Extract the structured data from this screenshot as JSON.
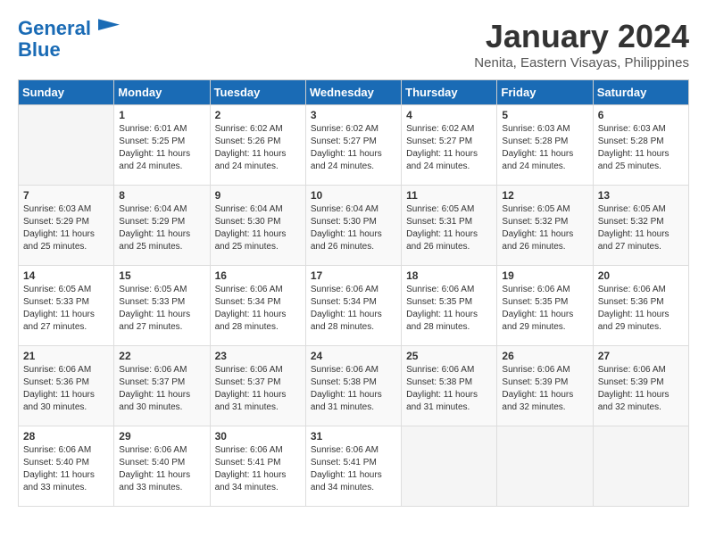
{
  "header": {
    "logo_line1": "General",
    "logo_line2": "Blue",
    "month": "January 2024",
    "location": "Nenita, Eastern Visayas, Philippines"
  },
  "weekdays": [
    "Sunday",
    "Monday",
    "Tuesday",
    "Wednesday",
    "Thursday",
    "Friday",
    "Saturday"
  ],
  "weeks": [
    [
      {
        "day": "",
        "info": ""
      },
      {
        "day": "1",
        "info": "Sunrise: 6:01 AM\nSunset: 5:25 PM\nDaylight: 11 hours\nand 24 minutes."
      },
      {
        "day": "2",
        "info": "Sunrise: 6:02 AM\nSunset: 5:26 PM\nDaylight: 11 hours\nand 24 minutes."
      },
      {
        "day": "3",
        "info": "Sunrise: 6:02 AM\nSunset: 5:27 PM\nDaylight: 11 hours\nand 24 minutes."
      },
      {
        "day": "4",
        "info": "Sunrise: 6:02 AM\nSunset: 5:27 PM\nDaylight: 11 hours\nand 24 minutes."
      },
      {
        "day": "5",
        "info": "Sunrise: 6:03 AM\nSunset: 5:28 PM\nDaylight: 11 hours\nand 24 minutes."
      },
      {
        "day": "6",
        "info": "Sunrise: 6:03 AM\nSunset: 5:28 PM\nDaylight: 11 hours\nand 25 minutes."
      }
    ],
    [
      {
        "day": "7",
        "info": "Sunrise: 6:03 AM\nSunset: 5:29 PM\nDaylight: 11 hours\nand 25 minutes."
      },
      {
        "day": "8",
        "info": "Sunrise: 6:04 AM\nSunset: 5:29 PM\nDaylight: 11 hours\nand 25 minutes."
      },
      {
        "day": "9",
        "info": "Sunrise: 6:04 AM\nSunset: 5:30 PM\nDaylight: 11 hours\nand 25 minutes."
      },
      {
        "day": "10",
        "info": "Sunrise: 6:04 AM\nSunset: 5:30 PM\nDaylight: 11 hours\nand 26 minutes."
      },
      {
        "day": "11",
        "info": "Sunrise: 6:05 AM\nSunset: 5:31 PM\nDaylight: 11 hours\nand 26 minutes."
      },
      {
        "day": "12",
        "info": "Sunrise: 6:05 AM\nSunset: 5:32 PM\nDaylight: 11 hours\nand 26 minutes."
      },
      {
        "day": "13",
        "info": "Sunrise: 6:05 AM\nSunset: 5:32 PM\nDaylight: 11 hours\nand 27 minutes."
      }
    ],
    [
      {
        "day": "14",
        "info": "Sunrise: 6:05 AM\nSunset: 5:33 PM\nDaylight: 11 hours\nand 27 minutes."
      },
      {
        "day": "15",
        "info": "Sunrise: 6:05 AM\nSunset: 5:33 PM\nDaylight: 11 hours\nand 27 minutes."
      },
      {
        "day": "16",
        "info": "Sunrise: 6:06 AM\nSunset: 5:34 PM\nDaylight: 11 hours\nand 28 minutes."
      },
      {
        "day": "17",
        "info": "Sunrise: 6:06 AM\nSunset: 5:34 PM\nDaylight: 11 hours\nand 28 minutes."
      },
      {
        "day": "18",
        "info": "Sunrise: 6:06 AM\nSunset: 5:35 PM\nDaylight: 11 hours\nand 28 minutes."
      },
      {
        "day": "19",
        "info": "Sunrise: 6:06 AM\nSunset: 5:35 PM\nDaylight: 11 hours\nand 29 minutes."
      },
      {
        "day": "20",
        "info": "Sunrise: 6:06 AM\nSunset: 5:36 PM\nDaylight: 11 hours\nand 29 minutes."
      }
    ],
    [
      {
        "day": "21",
        "info": "Sunrise: 6:06 AM\nSunset: 5:36 PM\nDaylight: 11 hours\nand 30 minutes."
      },
      {
        "day": "22",
        "info": "Sunrise: 6:06 AM\nSunset: 5:37 PM\nDaylight: 11 hours\nand 30 minutes."
      },
      {
        "day": "23",
        "info": "Sunrise: 6:06 AM\nSunset: 5:37 PM\nDaylight: 11 hours\nand 31 minutes."
      },
      {
        "day": "24",
        "info": "Sunrise: 6:06 AM\nSunset: 5:38 PM\nDaylight: 11 hours\nand 31 minutes."
      },
      {
        "day": "25",
        "info": "Sunrise: 6:06 AM\nSunset: 5:38 PM\nDaylight: 11 hours\nand 31 minutes."
      },
      {
        "day": "26",
        "info": "Sunrise: 6:06 AM\nSunset: 5:39 PM\nDaylight: 11 hours\nand 32 minutes."
      },
      {
        "day": "27",
        "info": "Sunrise: 6:06 AM\nSunset: 5:39 PM\nDaylight: 11 hours\nand 32 minutes."
      }
    ],
    [
      {
        "day": "28",
        "info": "Sunrise: 6:06 AM\nSunset: 5:40 PM\nDaylight: 11 hours\nand 33 minutes."
      },
      {
        "day": "29",
        "info": "Sunrise: 6:06 AM\nSunset: 5:40 PM\nDaylight: 11 hours\nand 33 minutes."
      },
      {
        "day": "30",
        "info": "Sunrise: 6:06 AM\nSunset: 5:41 PM\nDaylight: 11 hours\nand 34 minutes."
      },
      {
        "day": "31",
        "info": "Sunrise: 6:06 AM\nSunset: 5:41 PM\nDaylight: 11 hours\nand 34 minutes."
      },
      {
        "day": "",
        "info": ""
      },
      {
        "day": "",
        "info": ""
      },
      {
        "day": "",
        "info": ""
      }
    ]
  ]
}
